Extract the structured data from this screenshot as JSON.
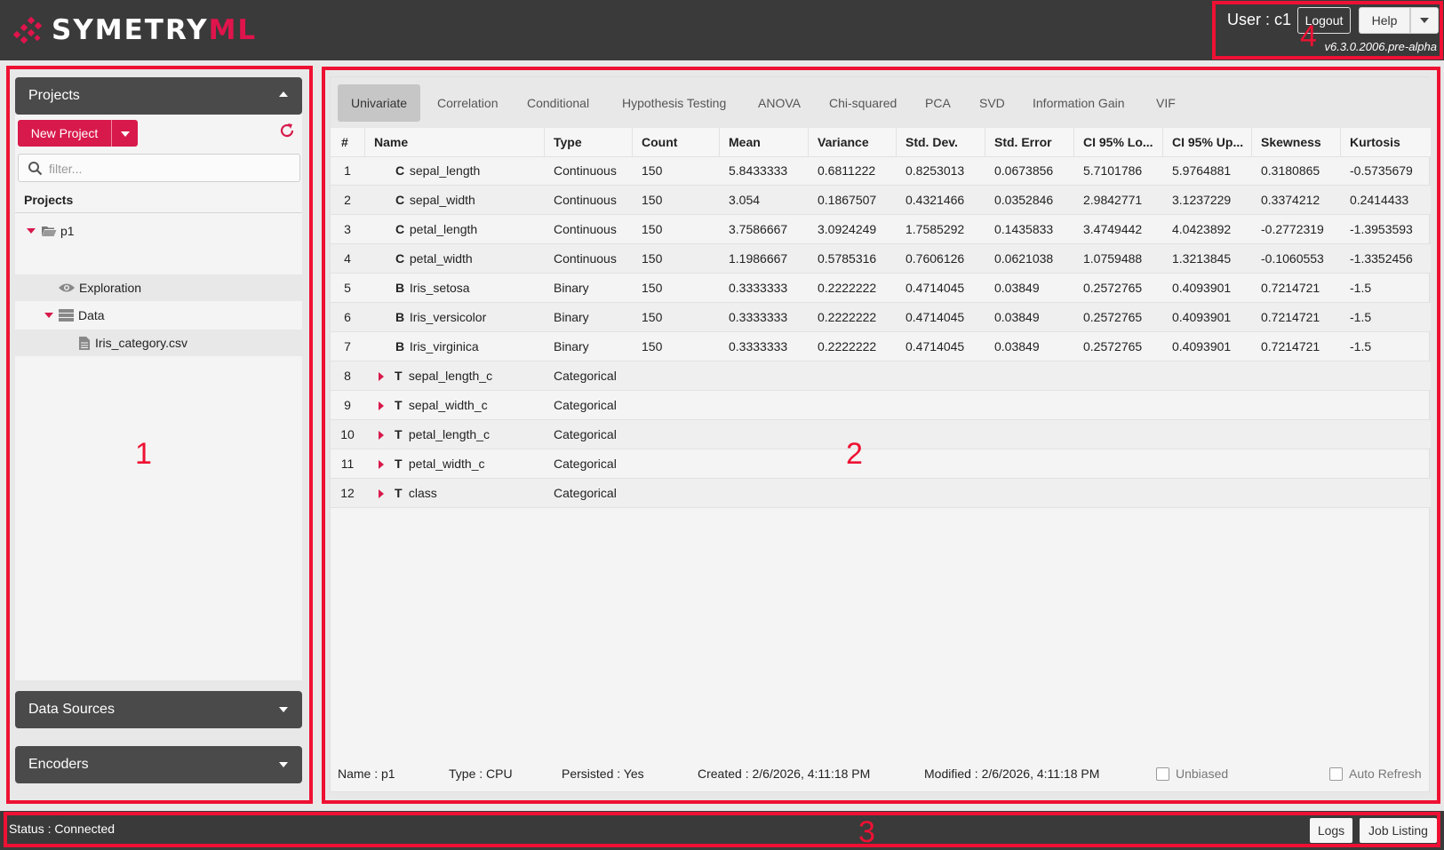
{
  "header": {
    "logo_text_1": "SYMETRY",
    "logo_text_2": "ML",
    "user_label": "User : c1",
    "logout_label": "Logout",
    "help_label": "Help",
    "version": "v6.3.0.2006.pre-alpha"
  },
  "annotations": {
    "n1": "1",
    "n2": "2",
    "n3": "3",
    "n4": "4"
  },
  "left": {
    "projects_title": "Projects",
    "new_project_label": "New Project",
    "filter_placeholder": "filter...",
    "tree_title": "Projects",
    "tree": {
      "project": "p1",
      "exploration": "Exploration",
      "data": "Data",
      "file": "Iris_category.csv"
    },
    "data_sources_title": "Data Sources",
    "encoders_title": "Encoders"
  },
  "tabs": [
    "Univariate",
    "Correlation",
    "Conditional",
    "Hypothesis Testing",
    "ANOVA",
    "Chi-squared",
    "PCA",
    "SVD",
    "Information Gain",
    "VIF"
  ],
  "grid": {
    "headers": [
      "#",
      "Name",
      "Type",
      "Count",
      "Mean",
      "Variance",
      "Std. Dev.",
      "Std. Error",
      "CI 95% Lo...",
      "CI 95% Up...",
      "Skewness",
      "Kurtosis"
    ],
    "rows": [
      {
        "n": "1",
        "letter": "C",
        "name": "sepal_length",
        "type": "Continuous",
        "count": "150",
        "mean": "5.8433333",
        "variance": "0.6811222",
        "std": "0.8253013",
        "se": "0.0673856",
        "lo": "5.7101786",
        "up": "5.9764881",
        "skew": "0.3180865",
        "kurt": "-0.5735679"
      },
      {
        "n": "2",
        "letter": "C",
        "name": "sepal_width",
        "type": "Continuous",
        "count": "150",
        "mean": "3.054",
        "variance": "0.1867507",
        "std": "0.4321466",
        "se": "0.0352846",
        "lo": "2.9842771",
        "up": "3.1237229",
        "skew": "0.3374212",
        "kurt": "0.2414433"
      },
      {
        "n": "3",
        "letter": "C",
        "name": "petal_length",
        "type": "Continuous",
        "count": "150",
        "mean": "3.7586667",
        "variance": "3.0924249",
        "std": "1.7585292",
        "se": "0.1435833",
        "lo": "3.4749442",
        "up": "4.0423892",
        "skew": "-0.2772319",
        "kurt": "-1.3953593"
      },
      {
        "n": "4",
        "letter": "C",
        "name": "petal_width",
        "type": "Continuous",
        "count": "150",
        "mean": "1.1986667",
        "variance": "0.5785316",
        "std": "0.7606126",
        "se": "0.0621038",
        "lo": "1.0759488",
        "up": "1.3213845",
        "skew": "-0.1060553",
        "kurt": "-1.3352456"
      },
      {
        "n": "5",
        "letter": "B",
        "name": "Iris_setosa",
        "type": "Binary",
        "count": "150",
        "mean": "0.3333333",
        "variance": "0.2222222",
        "std": "0.4714045",
        "se": "0.03849",
        "lo": "0.2572765",
        "up": "0.4093901",
        "skew": "0.7214721",
        "kurt": "-1.5"
      },
      {
        "n": "6",
        "letter": "B",
        "name": "Iris_versicolor",
        "type": "Binary",
        "count": "150",
        "mean": "0.3333333",
        "variance": "0.2222222",
        "std": "0.4714045",
        "se": "0.03849",
        "lo": "0.2572765",
        "up": "0.4093901",
        "skew": "0.7214721",
        "kurt": "-1.5"
      },
      {
        "n": "7",
        "letter": "B",
        "name": "Iris_virginica",
        "type": "Binary",
        "count": "150",
        "mean": "0.3333333",
        "variance": "0.2222222",
        "std": "0.4714045",
        "se": "0.03849",
        "lo": "0.2572765",
        "up": "0.4093901",
        "skew": "0.7214721",
        "kurt": "-1.5"
      },
      {
        "n": "8",
        "letter": "T",
        "name": "sepal_length_c",
        "type": "Categorical",
        "count": "",
        "mean": "",
        "variance": "",
        "std": "",
        "se": "",
        "lo": "",
        "up": "",
        "skew": "",
        "kurt": ""
      },
      {
        "n": "9",
        "letter": "T",
        "name": "sepal_width_c",
        "type": "Categorical",
        "count": "",
        "mean": "",
        "variance": "",
        "std": "",
        "se": "",
        "lo": "",
        "up": "",
        "skew": "",
        "kurt": ""
      },
      {
        "n": "10",
        "letter": "T",
        "name": "petal_length_c",
        "type": "Categorical",
        "count": "",
        "mean": "",
        "variance": "",
        "std": "",
        "se": "",
        "lo": "",
        "up": "",
        "skew": "",
        "kurt": ""
      },
      {
        "n": "11",
        "letter": "T",
        "name": "petal_width_c",
        "type": "Categorical",
        "count": "",
        "mean": "",
        "variance": "",
        "std": "",
        "se": "",
        "lo": "",
        "up": "",
        "skew": "",
        "kurt": ""
      },
      {
        "n": "12",
        "letter": "T",
        "name": "class",
        "type": "Categorical",
        "count": "",
        "mean": "",
        "variance": "",
        "std": "",
        "se": "",
        "lo": "",
        "up": "",
        "skew": "",
        "kurt": ""
      }
    ]
  },
  "footer": {
    "name": "Name : p1",
    "type": "Type : CPU",
    "persisted": "Persisted : Yes",
    "created": "Created : 2/6/2026, 4:11:18 PM",
    "modified": "Modified : 2/6/2026, 4:11:18 PM",
    "unbiased": "Unbiased",
    "auto_refresh": "Auto Refresh"
  },
  "status": {
    "text": "Status : Connected",
    "logs_label": "Logs",
    "jobs_label": "Job Listing"
  },
  "colors": {
    "accent": "#d8194b",
    "annotation": "#ee1133",
    "header_bg": "#3a3a3a"
  }
}
